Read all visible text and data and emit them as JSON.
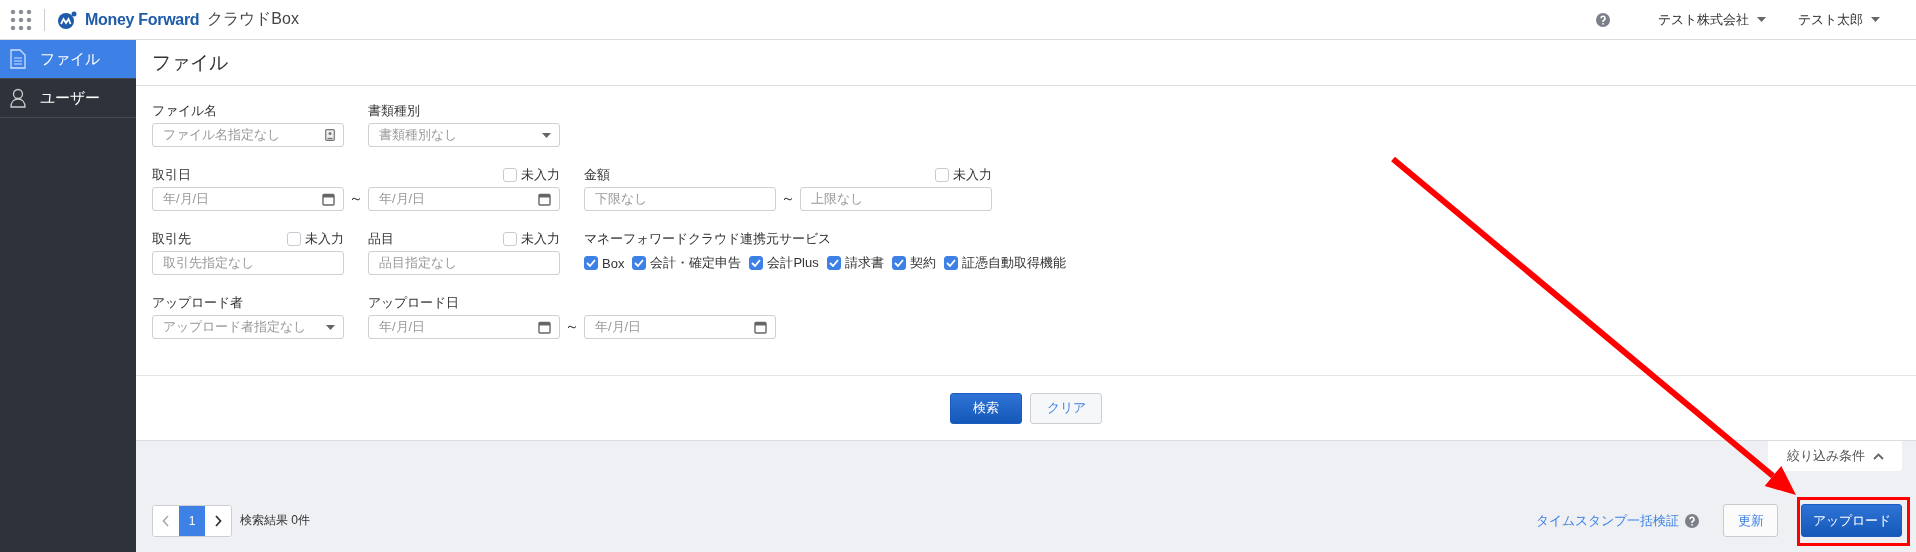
{
  "header": {
    "brand": "Money Forward",
    "product": "クラウドBox",
    "company": "テスト株式会社",
    "user": "テスト太郎"
  },
  "sidebar": {
    "items": [
      {
        "label": "ファイル",
        "selected": true
      },
      {
        "label": "ユーザー",
        "selected": false
      }
    ]
  },
  "page_title": "ファイル",
  "filters": {
    "rows": [
      [
        {
          "kind": "text_icon",
          "label": "ファイル名",
          "placeholder": "ファイル名指定なし"
        },
        {
          "kind": "select",
          "label": "書類種別",
          "placeholder": "書類種別なし"
        }
      ],
      [
        {
          "kind": "date_range",
          "label": "取引日",
          "from_placeholder": "年/月/日",
          "separator": "～",
          "to_placeholder": "年/月/日",
          "empty_option": {
            "label": "未入力",
            "checked": false
          }
        },
        {
          "kind": "range",
          "label": "金額",
          "from_placeholder": "下限なし",
          "separator": "～",
          "to_placeholder": "上限なし",
          "empty_option": {
            "label": "未入力",
            "checked": false
          }
        }
      ],
      [
        {
          "kind": "text",
          "label": "取引先",
          "placeholder": "取引先指定なし",
          "empty_option": {
            "label": "未入力",
            "checked": false
          }
        },
        {
          "kind": "text",
          "label": "品目",
          "placeholder": "品目指定なし",
          "empty_option": {
            "label": "未入力",
            "checked": false
          }
        },
        {
          "kind": "checks",
          "label": "マネーフォワードクラウド連携元サービス",
          "options": [
            {
              "label": "Box",
              "checked": true
            },
            {
              "label": "会計・確定申告",
              "checked": true
            },
            {
              "label": "会計Plus",
              "checked": true
            },
            {
              "label": "請求書",
              "checked": true
            },
            {
              "label": "契約",
              "checked": true
            },
            {
              "label": "証憑自動取得機能",
              "checked": true
            }
          ]
        }
      ],
      [
        {
          "kind": "select",
          "label": "アップロード者",
          "placeholder": "アップロード者指定なし"
        },
        {
          "kind": "date_range",
          "label": "アップロード日",
          "from_placeholder": "年/月/日",
          "separator": "～",
          "to_placeholder": "年/月/日"
        }
      ]
    ]
  },
  "search_button": "検索",
  "clear_button": "クリア",
  "collapse_tab": "絞り込み条件",
  "pagination": {
    "pages": [
      {
        "label": "1",
        "selected": true
      }
    ],
    "result": "検索結果 0件"
  },
  "timestamp_link": "タイムスタンプ一括検証",
  "refresh_button": "更新",
  "upload_button": "アップロード"
}
